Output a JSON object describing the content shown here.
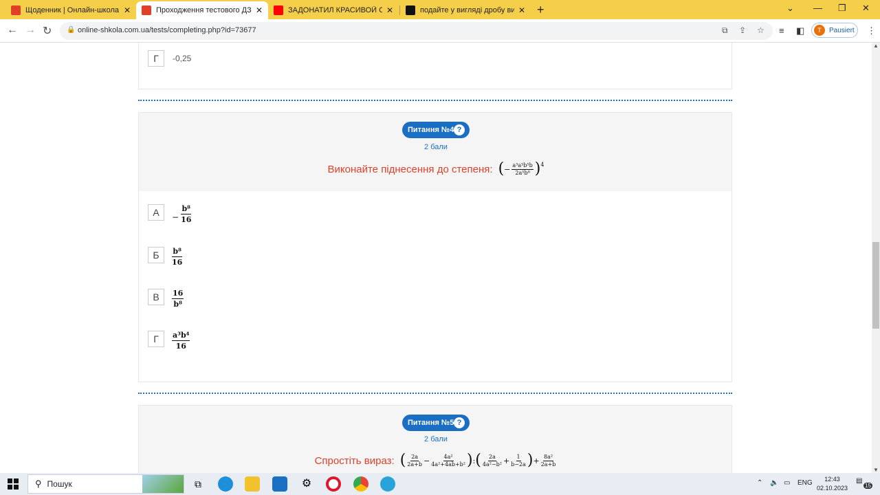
{
  "browser": {
    "tabs": [
      {
        "title": "Щоденник | Онлайн-школа «А",
        "icon": "calendar-icon",
        "color": "#e0402a"
      },
      {
        "title": "Проходження тестового ДЗ - С",
        "icon": "calendar-icon",
        "color": "#e0402a"
      },
      {
        "title": "ЗАДОНАТИЛ КРАСИВОЙ СТРИ",
        "icon": "youtube-icon",
        "color": "#ff0000"
      },
      {
        "title": "подайте у вигляді дробу вираз",
        "icon": "chat-icon",
        "color": "#111111"
      }
    ],
    "url": "online-shkola.com.ua/tests/completing.php?id=73677",
    "profile_label": "Pausiert",
    "profile_initial": "T"
  },
  "prev_question": {
    "last_option_letter": "Г",
    "last_option_text": "-0,25"
  },
  "question4": {
    "badge": "Питання №4",
    "help": "?",
    "points": "2 бали",
    "text": "Виконайте піднесення до степеня:",
    "expr_neg": "−",
    "expr_num": "a³a⁵b⁵b",
    "expr_den": "2a⁵b⁸",
    "expr_exp": "4",
    "options": [
      {
        "letter": "А",
        "neg": "−",
        "num": "b⁸",
        "den": "16"
      },
      {
        "letter": "Б",
        "neg": "",
        "num": "b⁸",
        "den": "16"
      },
      {
        "letter": "В",
        "neg": "",
        "num": "16",
        "den": "b⁸"
      },
      {
        "letter": "Г",
        "neg": "",
        "num": "a³b⁴",
        "den": "16"
      }
    ]
  },
  "question5": {
    "badge": "Питання №5",
    "help": "?",
    "points": "2 бали",
    "text": "Спростіть вираз:",
    "f1_num": "2a",
    "f1_den": "2a+b",
    "minus": "−",
    "f2_num": "4a²",
    "f2_den": "4a²+4ab+b²",
    "div": ":",
    "f3_num": "2a",
    "f3_den": "4a²−b²",
    "plus": "+",
    "f4_num": "1",
    "f4_den": "b−2a",
    "plus2": "+",
    "f5_num": "8a²",
    "f5_den": "2a+b"
  },
  "taskbar": {
    "search_label": "Пошук",
    "lang": "ENG",
    "time": "12:43",
    "date": "02.10.2023",
    "notif_count": "15"
  }
}
